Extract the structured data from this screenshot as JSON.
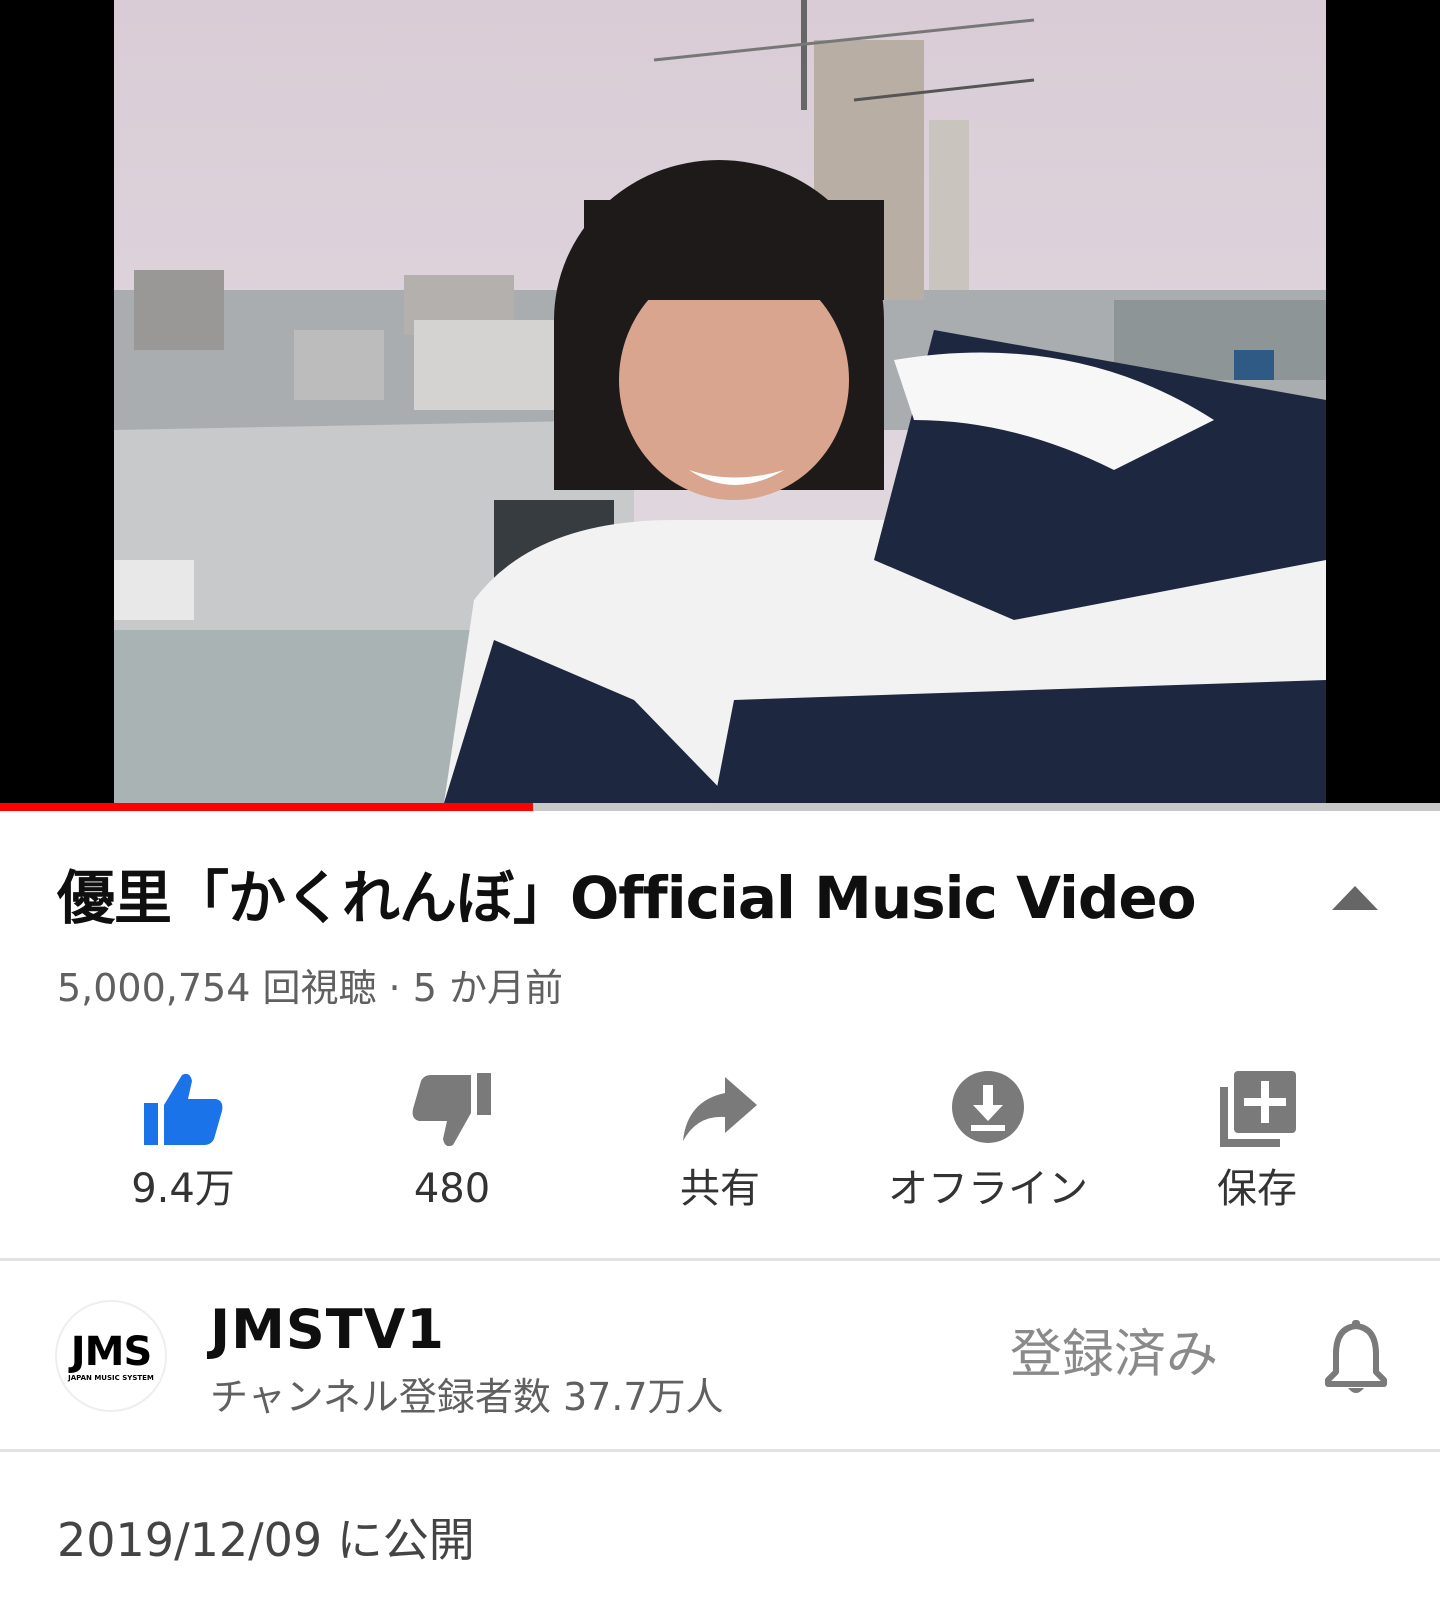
{
  "video": {
    "title": "優里「かくれんぼ」Official Music Video",
    "meta": "5,000,754 回視聴 · 5 か月前",
    "progress": 0.37
  },
  "actions": {
    "like": "9.4万",
    "dislike": "480",
    "share": "共有",
    "offline": "オフライン",
    "save": "保存"
  },
  "channel": {
    "avatar_logo": "JMS",
    "avatar_sub": "JAPAN MUSIC SYSTEM",
    "name": "JMSTV1",
    "subscribers": "チャンネル登録者数 37.7万人",
    "subscribe_label": "登録済み"
  },
  "published": "2019/12/09 に公開",
  "icons": [
    "thumbs-up-icon",
    "thumbs-down-icon",
    "share-icon",
    "download-icon",
    "playlist-add-icon",
    "bell-icon",
    "chevron-up-icon"
  ],
  "colors": {
    "accent_red": "#ff0000",
    "like_active": "#1a73e8",
    "icon_gray": "#7a7a7a",
    "text_secondary": "#606060"
  }
}
